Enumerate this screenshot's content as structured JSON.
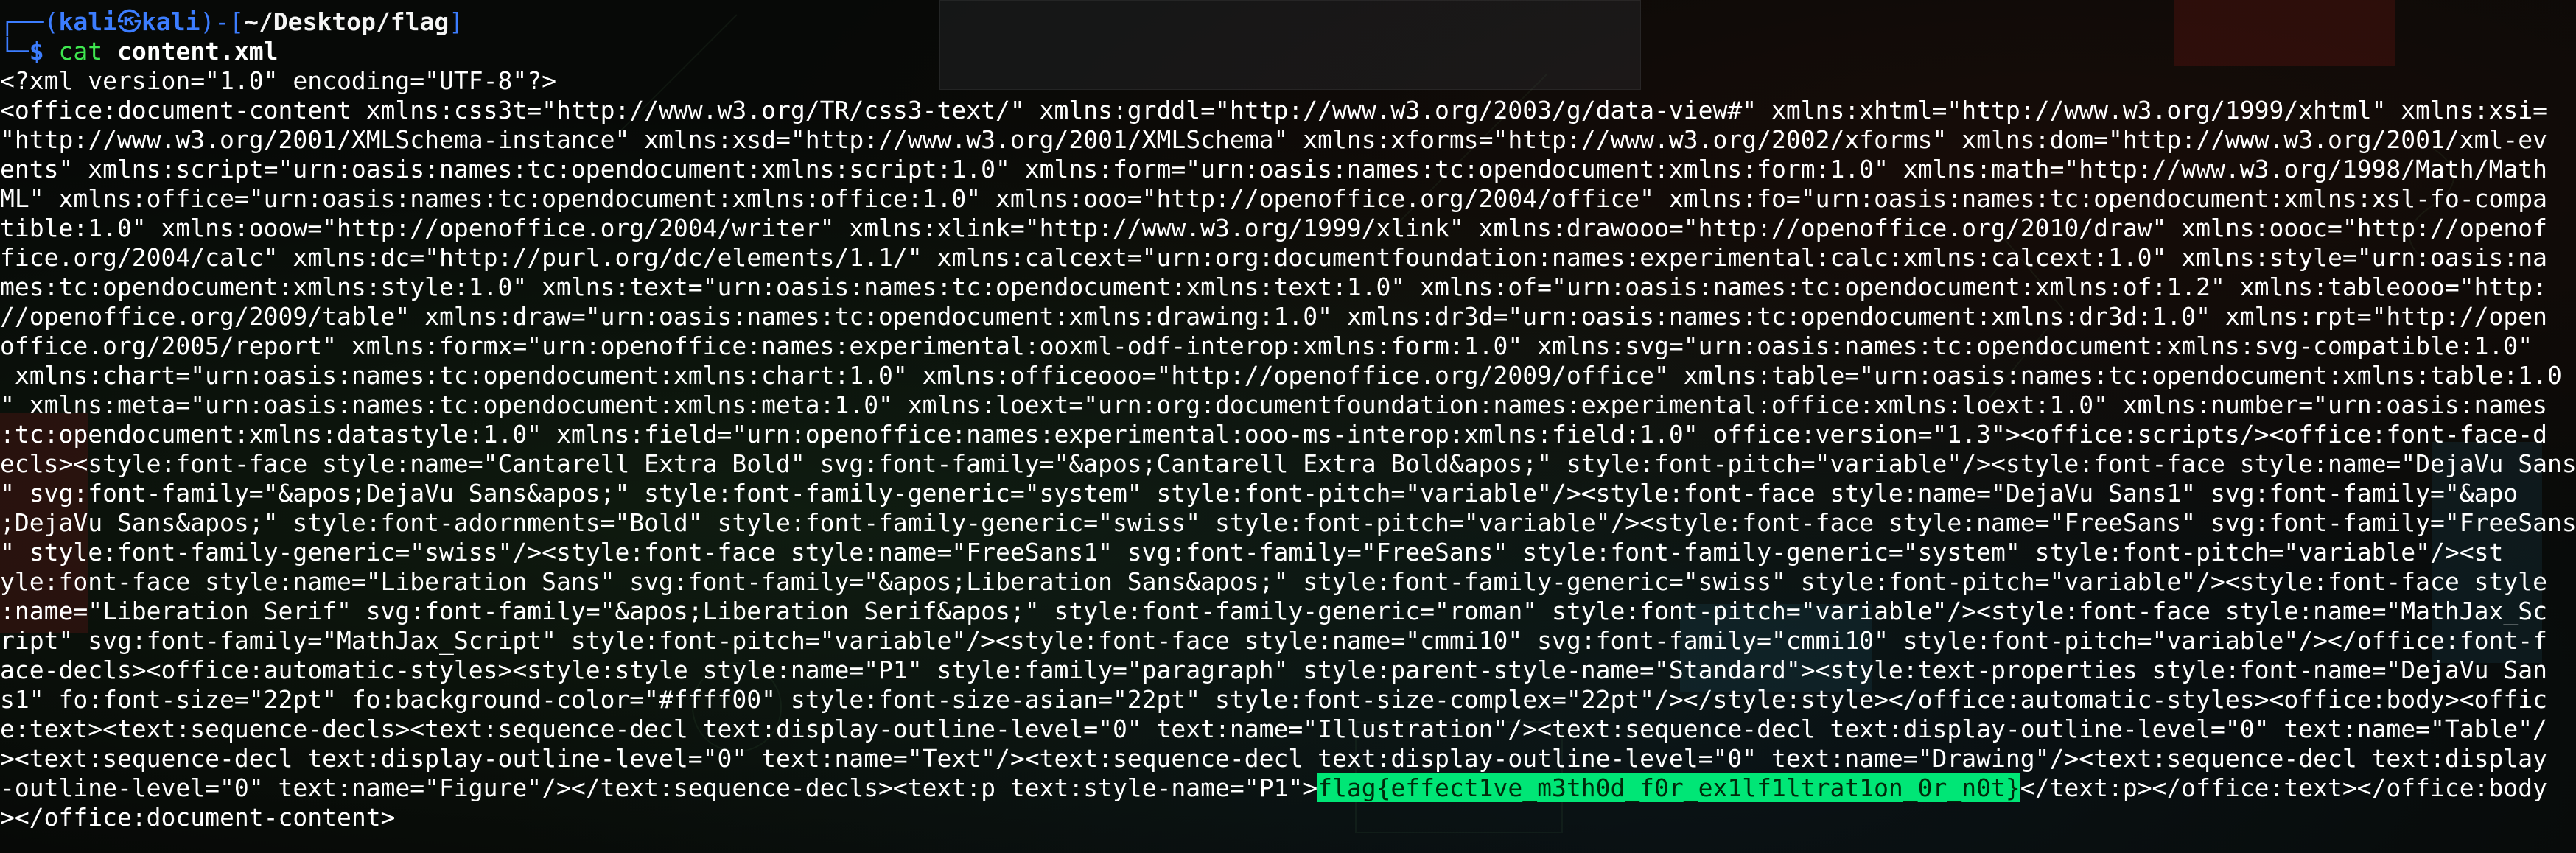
{
  "prompt": {
    "frame_top": "┌──(",
    "user": "kali",
    "at_symbol": "㉿",
    "host": "kali",
    "mid": ")-[",
    "path": "~/Desktop/flag",
    "end": "]",
    "frame_bottom": "└─",
    "dollar": "$ ",
    "command": "cat",
    "argument": " content.xml"
  },
  "output_lines": [
    "<?xml version=\"1.0\" encoding=\"UTF-8\"?>",
    "<office:document-content xmlns:css3t=\"http://www.w3.org/TR/css3-text/\" xmlns:grddl=\"http://www.w3.org/2003/g/data-view#\" xmlns:xhtml=\"http://www.w3.org/1999/xhtml\" xmlns:xsi=",
    "\"http://www.w3.org/2001/XMLSchema-instance\" xmlns:xsd=\"http://www.w3.org/2001/XMLSchema\" xmlns:xforms=\"http://www.w3.org/2002/xforms\" xmlns:dom=\"http://www.w3.org/2001/xml-ev",
    "ents\" xmlns:script=\"urn:oasis:names:tc:opendocument:xmlns:script:1.0\" xmlns:form=\"urn:oasis:names:tc:opendocument:xmlns:form:1.0\" xmlns:math=\"http://www.w3.org/1998/Math/Math",
    "ML\" xmlns:office=\"urn:oasis:names:tc:opendocument:xmlns:office:1.0\" xmlns:ooo=\"http://openoffice.org/2004/office\" xmlns:fo=\"urn:oasis:names:tc:opendocument:xmlns:xsl-fo-compa",
    "tible:1.0\" xmlns:ooow=\"http://openoffice.org/2004/writer\" xmlns:xlink=\"http://www.w3.org/1999/xlink\" xmlns:drawooo=\"http://openoffice.org/2010/draw\" xmlns:oooc=\"http://openof",
    "fice.org/2004/calc\" xmlns:dc=\"http://purl.org/dc/elements/1.1/\" xmlns:calcext=\"urn:org:documentfoundation:names:experimental:calc:xmlns:calcext:1.0\" xmlns:style=\"urn:oasis:na",
    "mes:tc:opendocument:xmlns:style:1.0\" xmlns:text=\"urn:oasis:names:tc:opendocument:xmlns:text:1.0\" xmlns:of=\"urn:oasis:names:tc:opendocument:xmlns:of:1.2\" xmlns:tableooo=\"http:",
    "//openoffice.org/2009/table\" xmlns:draw=\"urn:oasis:names:tc:opendocument:xmlns:drawing:1.0\" xmlns:dr3d=\"urn:oasis:names:tc:opendocument:xmlns:dr3d:1.0\" xmlns:rpt=\"http://open",
    "office.org/2005/report\" xmlns:formx=\"urn:openoffice:names:experimental:ooxml-odf-interop:xmlns:form:1.0\" xmlns:svg=\"urn:oasis:names:tc:opendocument:xmlns:svg-compatible:1.0\"",
    " xmlns:chart=\"urn:oasis:names:tc:opendocument:xmlns:chart:1.0\" xmlns:officeooo=\"http://openoffice.org/2009/office\" xmlns:table=\"urn:oasis:names:tc:opendocument:xmlns:table:1.0",
    "\" xmlns:meta=\"urn:oasis:names:tc:opendocument:xmlns:meta:1.0\" xmlns:loext=\"urn:org:documentfoundation:names:experimental:office:xmlns:loext:1.0\" xmlns:number=\"urn:oasis:names",
    ":tc:opendocument:xmlns:datastyle:1.0\" xmlns:field=\"urn:openoffice:names:experimental:ooo-ms-interop:xmlns:field:1.0\" office:version=\"1.3\"><office:scripts/><office:font-face-d",
    "ecls><style:font-face style:name=\"Cantarell Extra Bold\" svg:font-family=\"&apos;Cantarell Extra Bold&apos;\" style:font-pitch=\"variable\"/><style:font-face style:name=\"DejaVu Sans",
    "\" svg:font-family=\"&apos;DejaVu Sans&apos;\" style:font-family-generic=\"system\" style:font-pitch=\"variable\"/><style:font-face style:name=\"DejaVu Sans1\" svg:font-family=\"&apo",
    ";DejaVu Sans&apos;\" style:font-adornments=\"Bold\" style:font-family-generic=\"swiss\" style:font-pitch=\"variable\"/><style:font-face style:name=\"FreeSans\" svg:font-family=\"FreeSans",
    "\" style:font-family-generic=\"swiss\"/><style:font-face style:name=\"FreeSans1\" svg:font-family=\"FreeSans\" style:font-family-generic=\"system\" style:font-pitch=\"variable\"/><st",
    "yle:font-face style:name=\"Liberation Sans\" svg:font-family=\"&apos;Liberation Sans&apos;\" style:font-family-generic=\"swiss\" style:font-pitch=\"variable\"/><style:font-face style",
    ":name=\"Liberation Serif\" svg:font-family=\"&apos;Liberation Serif&apos;\" style:font-family-generic=\"roman\" style:font-pitch=\"variable\"/><style:font-face style:name=\"MathJax_Sc",
    "ript\" svg:font-family=\"MathJax_Script\" style:font-pitch=\"variable\"/><style:font-face style:name=\"cmmi10\" svg:font-family=\"cmmi10\" style:font-pitch=\"variable\"/></office:font-f",
    "ace-decls><office:automatic-styles><style:style style:name=\"P1\" style:family=\"paragraph\" style:parent-style-name=\"Standard\"><style:text-properties style:font-name=\"DejaVu San",
    "s1\" fo:font-size=\"22pt\" fo:background-color=\"#ffff00\" style:font-size-asian=\"22pt\" style:font-size-complex=\"22pt\"/></style:style></office:automatic-styles><office:body><offic",
    "e:text><text:sequence-decls><text:sequence-decl text:display-outline-level=\"0\" text:name=\"Illustration\"/><text:sequence-decl text:display-outline-level=\"0\" text:name=\"Table\"/",
    "><text:sequence-decl text:display-outline-level=\"0\" text:name=\"Text\"/><text:sequence-decl text:display-outline-level=\"0\" text:name=\"Drawing\"/><text:sequence-decl text:display"
  ],
  "final_line": {
    "before": "-outline-level=\"0\" text:name=\"Figure\"/></text:sequence-decls><text:p text:style-name=\"P1\">",
    "flag": "flag{effect1ve_m3th0d_f0r_ex1lf1ltrat1on_0r_n0t}",
    "after": "</text:p></office:text></office:body"
  },
  "closing_line": "></office:document-content>"
}
